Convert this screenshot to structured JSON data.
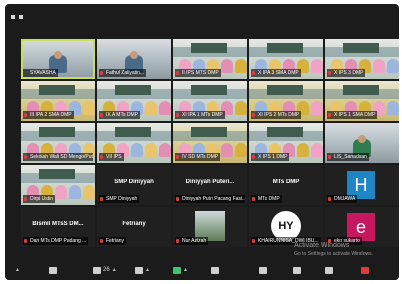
{
  "window": {
    "controls": [
      "pin-icon",
      "grid-view-icon"
    ]
  },
  "tiles": [
    {
      "label": "SYAVASHA",
      "style": "vid",
      "speaking": true,
      "mic_off": false
    },
    {
      "label": "Fathul Zaliyatin...",
      "style": "vid",
      "mic_off": true
    },
    {
      "label": "II IPS MTS DMP",
      "style": "room",
      "mic_off": true
    },
    {
      "label": "X IPA 3 SMA DMP",
      "style": "room",
      "mic_off": true
    },
    {
      "label": "X IPS 3 DMP",
      "style": "room",
      "mic_off": true
    },
    {
      "label": "III IPA 2 SMA DMP",
      "style": "yellow",
      "mic_off": true
    },
    {
      "label": "IX A MTs DMP",
      "style": "room",
      "mic_off": true
    },
    {
      "label": "XI IPA 1 MTs DMP",
      "style": "room",
      "mic_off": true
    },
    {
      "label": "XI IPS 2 MTs DMP",
      "style": "yellow",
      "mic_off": true
    },
    {
      "label": "X IPS 1 SMA DMP",
      "style": "yellow",
      "mic_off": true
    },
    {
      "label": "Sekolah Wali SD Mengo/Putri...",
      "style": "room",
      "mic_off": true
    },
    {
      "label": "VII IPS",
      "style": "room",
      "mic_off": true
    },
    {
      "label": "IV SD MTs DMP",
      "style": "yellow",
      "mic_off": true
    },
    {
      "label": "X IPS 1 DMP",
      "style": "room",
      "mic_off": true
    },
    {
      "label": "LIS_Sanadsan",
      "style": "vid",
      "mic_off": true
    },
    {
      "label": "Dirpi Ustin",
      "style": "room",
      "mic_off": true
    },
    {
      "label": "SMP Diniyyah",
      "center": "SMP Diniyyah",
      "style": "dark",
      "mic_off": true
    },
    {
      "label": "Diniyyah Putri Pacang Fasi...",
      "center": "Diniyyah Puteri...",
      "style": "dark",
      "mic_off": true
    },
    {
      "label": "MTs DMP",
      "center": "MTs DMP",
      "style": "dark",
      "mic_off": true
    },
    {
      "label": "DMJAWA",
      "avatar": "H",
      "avatar_color": "#1f86c4",
      "style": "dark",
      "mic_off": true
    },
    {
      "label": "Dari MTs DMP Padang ...",
      "center": "Bismil MTsS DM...",
      "style": "dark",
      "mic_off": true
    },
    {
      "label": "Fetriany",
      "center": "Fetriany",
      "style": "dark",
      "mic_off": true
    },
    {
      "label": "Nur Azizah",
      "photo": true,
      "style": "dark",
      "mic_off": true
    },
    {
      "label": "KHAIRUNNISA_DWI IBU...",
      "logo": "HY",
      "style": "dark",
      "mic_off": true
    },
    {
      "label": "eko sukarto",
      "avatar": "e",
      "avatar_color": "#c7185f",
      "style": "dark",
      "mic_off": true
    }
  ],
  "toolbar": {
    "items": [
      {
        "icon": "caret-up-icon",
        "label": ""
      },
      {
        "icon": "shield-icon",
        "label": ""
      },
      {
        "icon": "participants-icon",
        "label": "26"
      },
      {
        "icon": "chat-icon",
        "label": ""
      },
      {
        "icon": "share-screen-icon",
        "label": ""
      },
      {
        "icon": "record-icon",
        "label": ""
      },
      {
        "icon": "breakout-rooms-icon",
        "label": ""
      },
      {
        "icon": "apps-icon",
        "label": ""
      },
      {
        "icon": "reactions-icon",
        "label": ""
      },
      {
        "icon": "whiteboard-icon",
        "label": ""
      },
      {
        "icon": "more-icon",
        "label": ""
      }
    ]
  },
  "watermark": {
    "title": "Activate Windows",
    "subtitle": "Go to Settings to activate Windows."
  }
}
